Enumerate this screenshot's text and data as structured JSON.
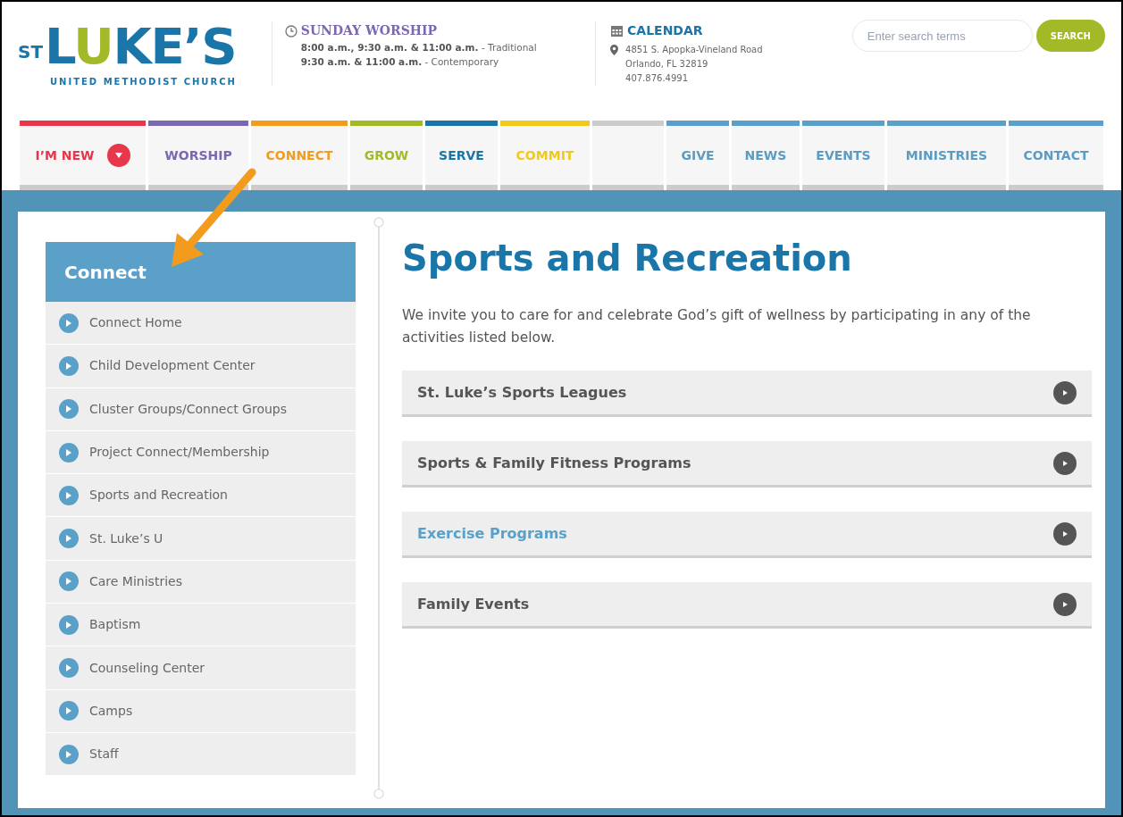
{
  "logo": {
    "st": "ST",
    "name_parts": [
      "L",
      "U",
      "KE’S"
    ],
    "subtitle": "UNITED METHODIST CHURCH"
  },
  "worship": {
    "title": "SUNDAY WORSHIP",
    "lines": [
      {
        "times": "8:00 a.m., 9:30 a.m. & 11:00 a.m.",
        "label": "- Traditional"
      },
      {
        "times": "9:30 a.m. & 11:00 a.m.",
        "label": "- Contemporary"
      }
    ]
  },
  "calendar": {
    "title": "CALENDAR",
    "address": [
      "4851 S. Apopka-Vineland Road",
      "Orlando, FL 32819",
      "407.876.4991"
    ]
  },
  "search": {
    "placeholder": "Enter search terms",
    "button": "SEARCH"
  },
  "nav_left": [
    {
      "label": "I’M NEW",
      "color": "#e8374a",
      "kind": "dropdown"
    },
    {
      "label": "WORSHIP",
      "color": "#7b68b0",
      "kind": "plain"
    },
    {
      "label": "CONNECT",
      "color": "#f29b1d",
      "kind": "plain"
    },
    {
      "label": "GROW",
      "color": "#a4b928",
      "kind": "plain"
    },
    {
      "label": "SERVE",
      "color": "#1a75a9",
      "kind": "plain"
    },
    {
      "label": "COMMIT",
      "color": "#f0c81e",
      "kind": "plain"
    }
  ],
  "nav_right": [
    "GIVE",
    "NEWS",
    "EVENTS",
    "MINISTRIES",
    "CONTACT"
  ],
  "sidebar": {
    "title": "Connect",
    "items": [
      {
        "label": "Connect Home"
      },
      {
        "label": "Child Development Center"
      },
      {
        "label": "Cluster Groups/Connect Groups"
      },
      {
        "label": "Project Connect/Membership"
      },
      {
        "label": "Sports and Recreation"
      },
      {
        "label": "St. Luke’s U"
      },
      {
        "label": "Care Ministries"
      },
      {
        "label": "Baptism"
      },
      {
        "label": "Counseling Center"
      },
      {
        "label": "Camps"
      },
      {
        "label": "Staff"
      }
    ]
  },
  "main": {
    "title": "Sports and Recreation",
    "intro": "We invite you to care for and celebrate God’s gift of wellness by participating in any of the activities listed below.",
    "sections": [
      {
        "label": "St. Luke’s Sports Leagues",
        "selected": false
      },
      {
        "label": "Sports & Family Fitness Programs",
        "selected": false
      },
      {
        "label": "Exercise Programs",
        "selected": true
      },
      {
        "label": "Family Events",
        "selected": false
      }
    ]
  }
}
